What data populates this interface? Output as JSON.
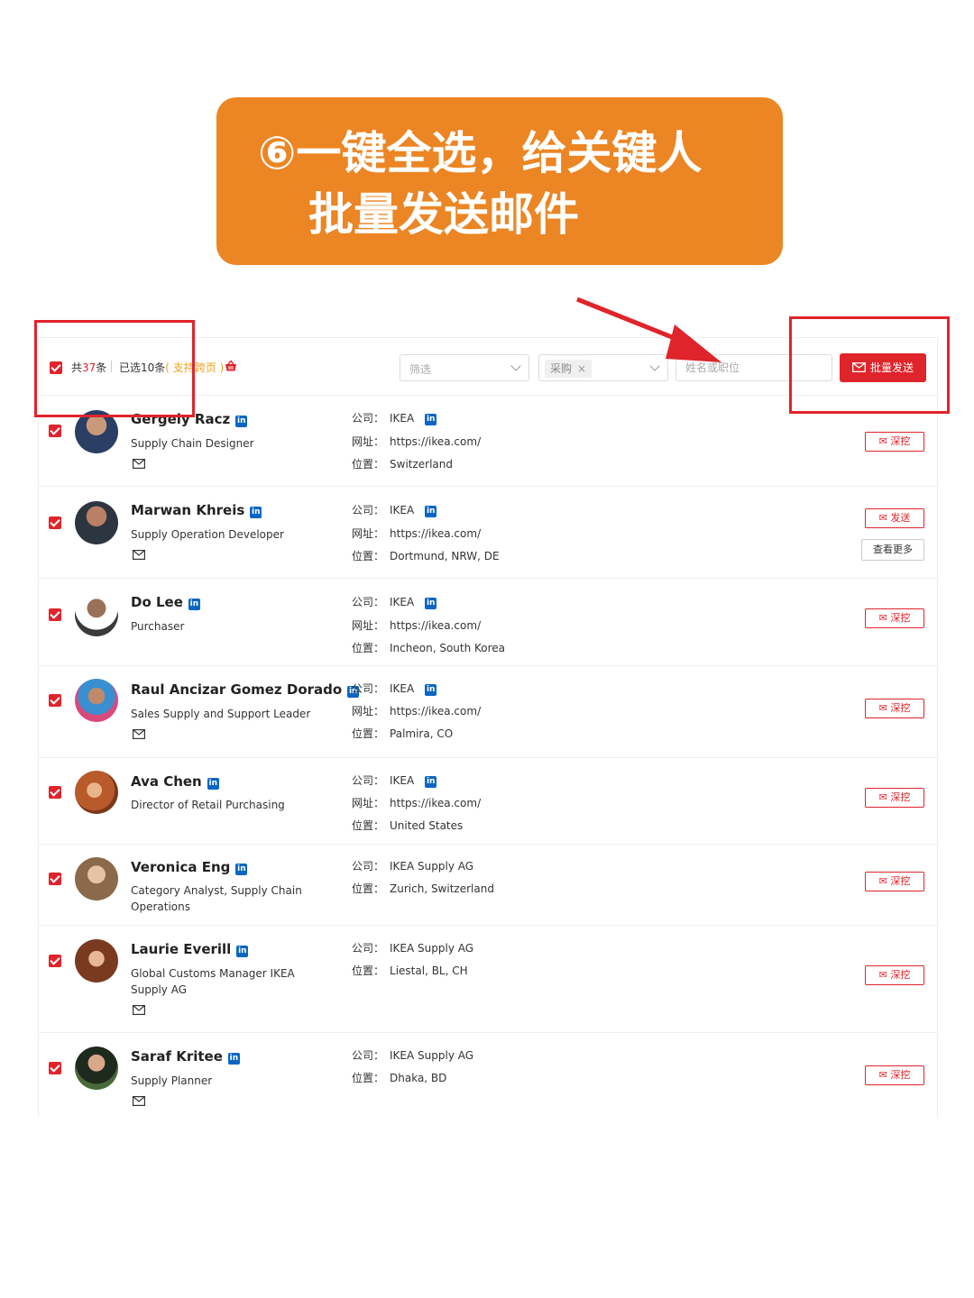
{
  "banner": {
    "line1": "⑥一键全选，给关键人",
    "line2": "批量发送邮件"
  },
  "toolbar": {
    "total_prefix": "共",
    "total_count": "37",
    "total_suffix": "条",
    "selected_text": "已选10条",
    "support_text": "( 支持跨页 )",
    "filter_placeholder": "筛选",
    "tag_label": "采购",
    "search_placeholder": "姓名或职位",
    "bulk_send_label": "批量发送"
  },
  "labels": {
    "company": "公司：",
    "website": "网址：",
    "location": "位置：",
    "dig": "深挖",
    "send": "发送",
    "more": "查看更多",
    "li": "in"
  },
  "contacts": [
    {
      "name": "Gergely Racz",
      "title": "Supply Chain Designer",
      "company": "IKEA",
      "website": "https://ikea.com/",
      "location": "Switzerland"
    },
    {
      "name": "Marwan Khreis",
      "title": "Supply Operation Developer",
      "company": "IKEA",
      "website": "https://ikea.com/",
      "location": "Dortmund, NRW, DE"
    },
    {
      "name": "Do Lee",
      "title": "Purchaser",
      "company": "IKEA",
      "website": "https://ikea.com/",
      "location": "Incheon, South Korea"
    },
    {
      "name": "Raul Ancizar Gomez Dorado",
      "title": "Sales Supply and Support Leader",
      "company": "IKEA",
      "website": "https://ikea.com/",
      "location": "Palmira, CO"
    },
    {
      "name": "Ava Chen",
      "title": "Director of Retail Purchasing",
      "company": "IKEA",
      "website": "https://ikea.com/",
      "location": "United States"
    },
    {
      "name": "Veronica Eng",
      "title": "Category Analyst, Supply Chain Operations",
      "company": "IKEA Supply AG",
      "location": "Zurich, Switzerland"
    },
    {
      "name": "Laurie Everill",
      "title": "Global Customs Manager IKEA Supply AG",
      "company": "IKEA Supply AG",
      "location": "Liestal, BL, CH"
    },
    {
      "name": "Saraf Kritee",
      "title": "Supply Planner",
      "company": "IKEA Supply AG",
      "location": "Dhaka, BD"
    }
  ],
  "colors": {
    "accent_red": "#e0242b",
    "banner_orange": "#ec8523",
    "linkedin_blue": "#0a66c2"
  }
}
